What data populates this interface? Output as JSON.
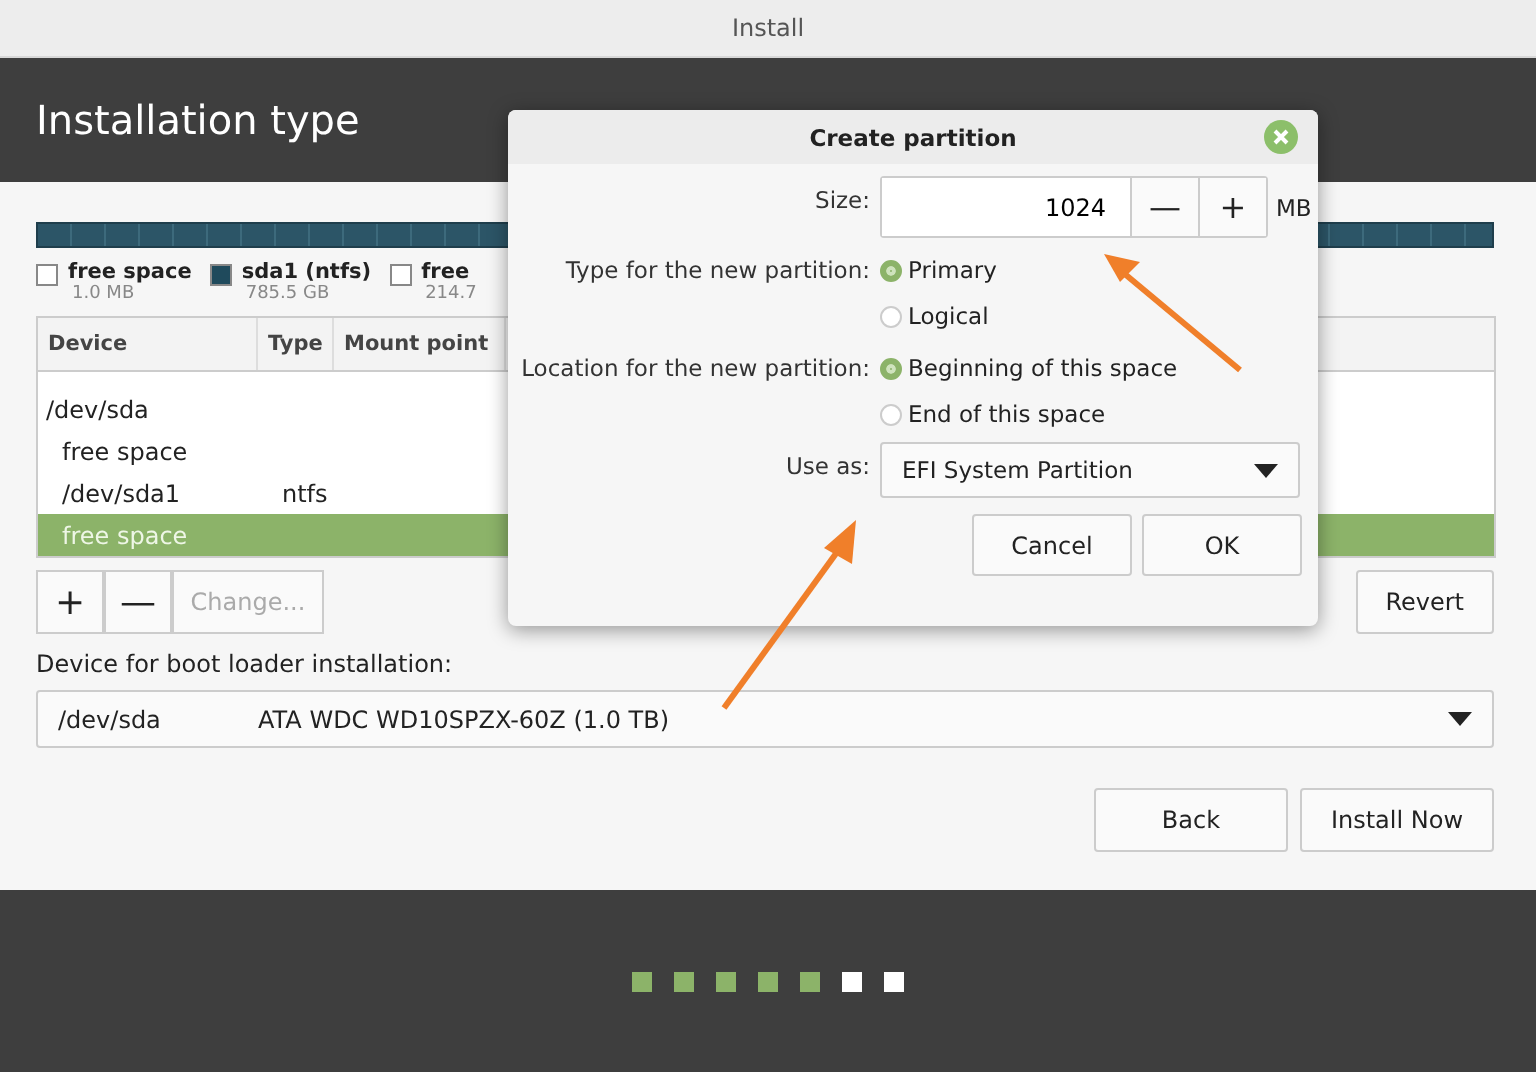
{
  "window": {
    "title": "Install"
  },
  "header": {
    "title": "Installation type"
  },
  "legend": [
    {
      "label": "free space",
      "size": "1.0 MB",
      "color": "#ffffff"
    },
    {
      "label": "sda1 (ntfs)",
      "size": "785.5 GB",
      "color": "#1f4a5c"
    },
    {
      "label": "free",
      "size": "214.7",
      "color": "#ffffff"
    }
  ],
  "table": {
    "columns": [
      "Device",
      "Type",
      "Mount point"
    ],
    "rows": [
      {
        "device": "/dev/sda",
        "selected": false,
        "children": [
          {
            "device": "free space",
            "selected": false
          },
          {
            "device": "/dev/sda1",
            "type": "ntfs",
            "selected": false
          },
          {
            "device": "free space",
            "selected": true
          }
        ]
      }
    ]
  },
  "table_buttons": [
    {
      "label": "+",
      "disabled": false
    },
    {
      "label": "—",
      "disabled": false
    },
    {
      "label": "Change...",
      "disabled": true
    }
  ],
  "revert_button": "Revert",
  "boot_loader": {
    "label": "Device for boot loader installation:",
    "device": "/dev/sda",
    "description": "ATA WDC WD10SPZX-60Z (1.0 TB)"
  },
  "footer_buttons": [
    "Back",
    "Install Now"
  ],
  "steps": [
    {
      "done": true
    },
    {
      "done": true
    },
    {
      "done": true
    },
    {
      "done": true
    },
    {
      "done": true
    },
    {
      "done": false
    },
    {
      "done": false
    }
  ],
  "dialog": {
    "title": "Create partition",
    "size_label": "Size:",
    "size_value": "1024",
    "minus": "—",
    "plus": "+",
    "unit": "MB",
    "type_label": "Type for the new partition:",
    "type_options": [
      {
        "label": "Primary",
        "selected": true
      },
      {
        "label": "Logical",
        "selected": false
      }
    ],
    "location_label": "Location for the new partition:",
    "location_options": [
      {
        "label": "Beginning of this space",
        "selected": true
      },
      {
        "label": "End of this space",
        "selected": false
      }
    ],
    "use_as_label": "Use as:",
    "use_as_value": "EFI System Partition",
    "buttons": [
      "Cancel",
      "OK"
    ]
  }
}
